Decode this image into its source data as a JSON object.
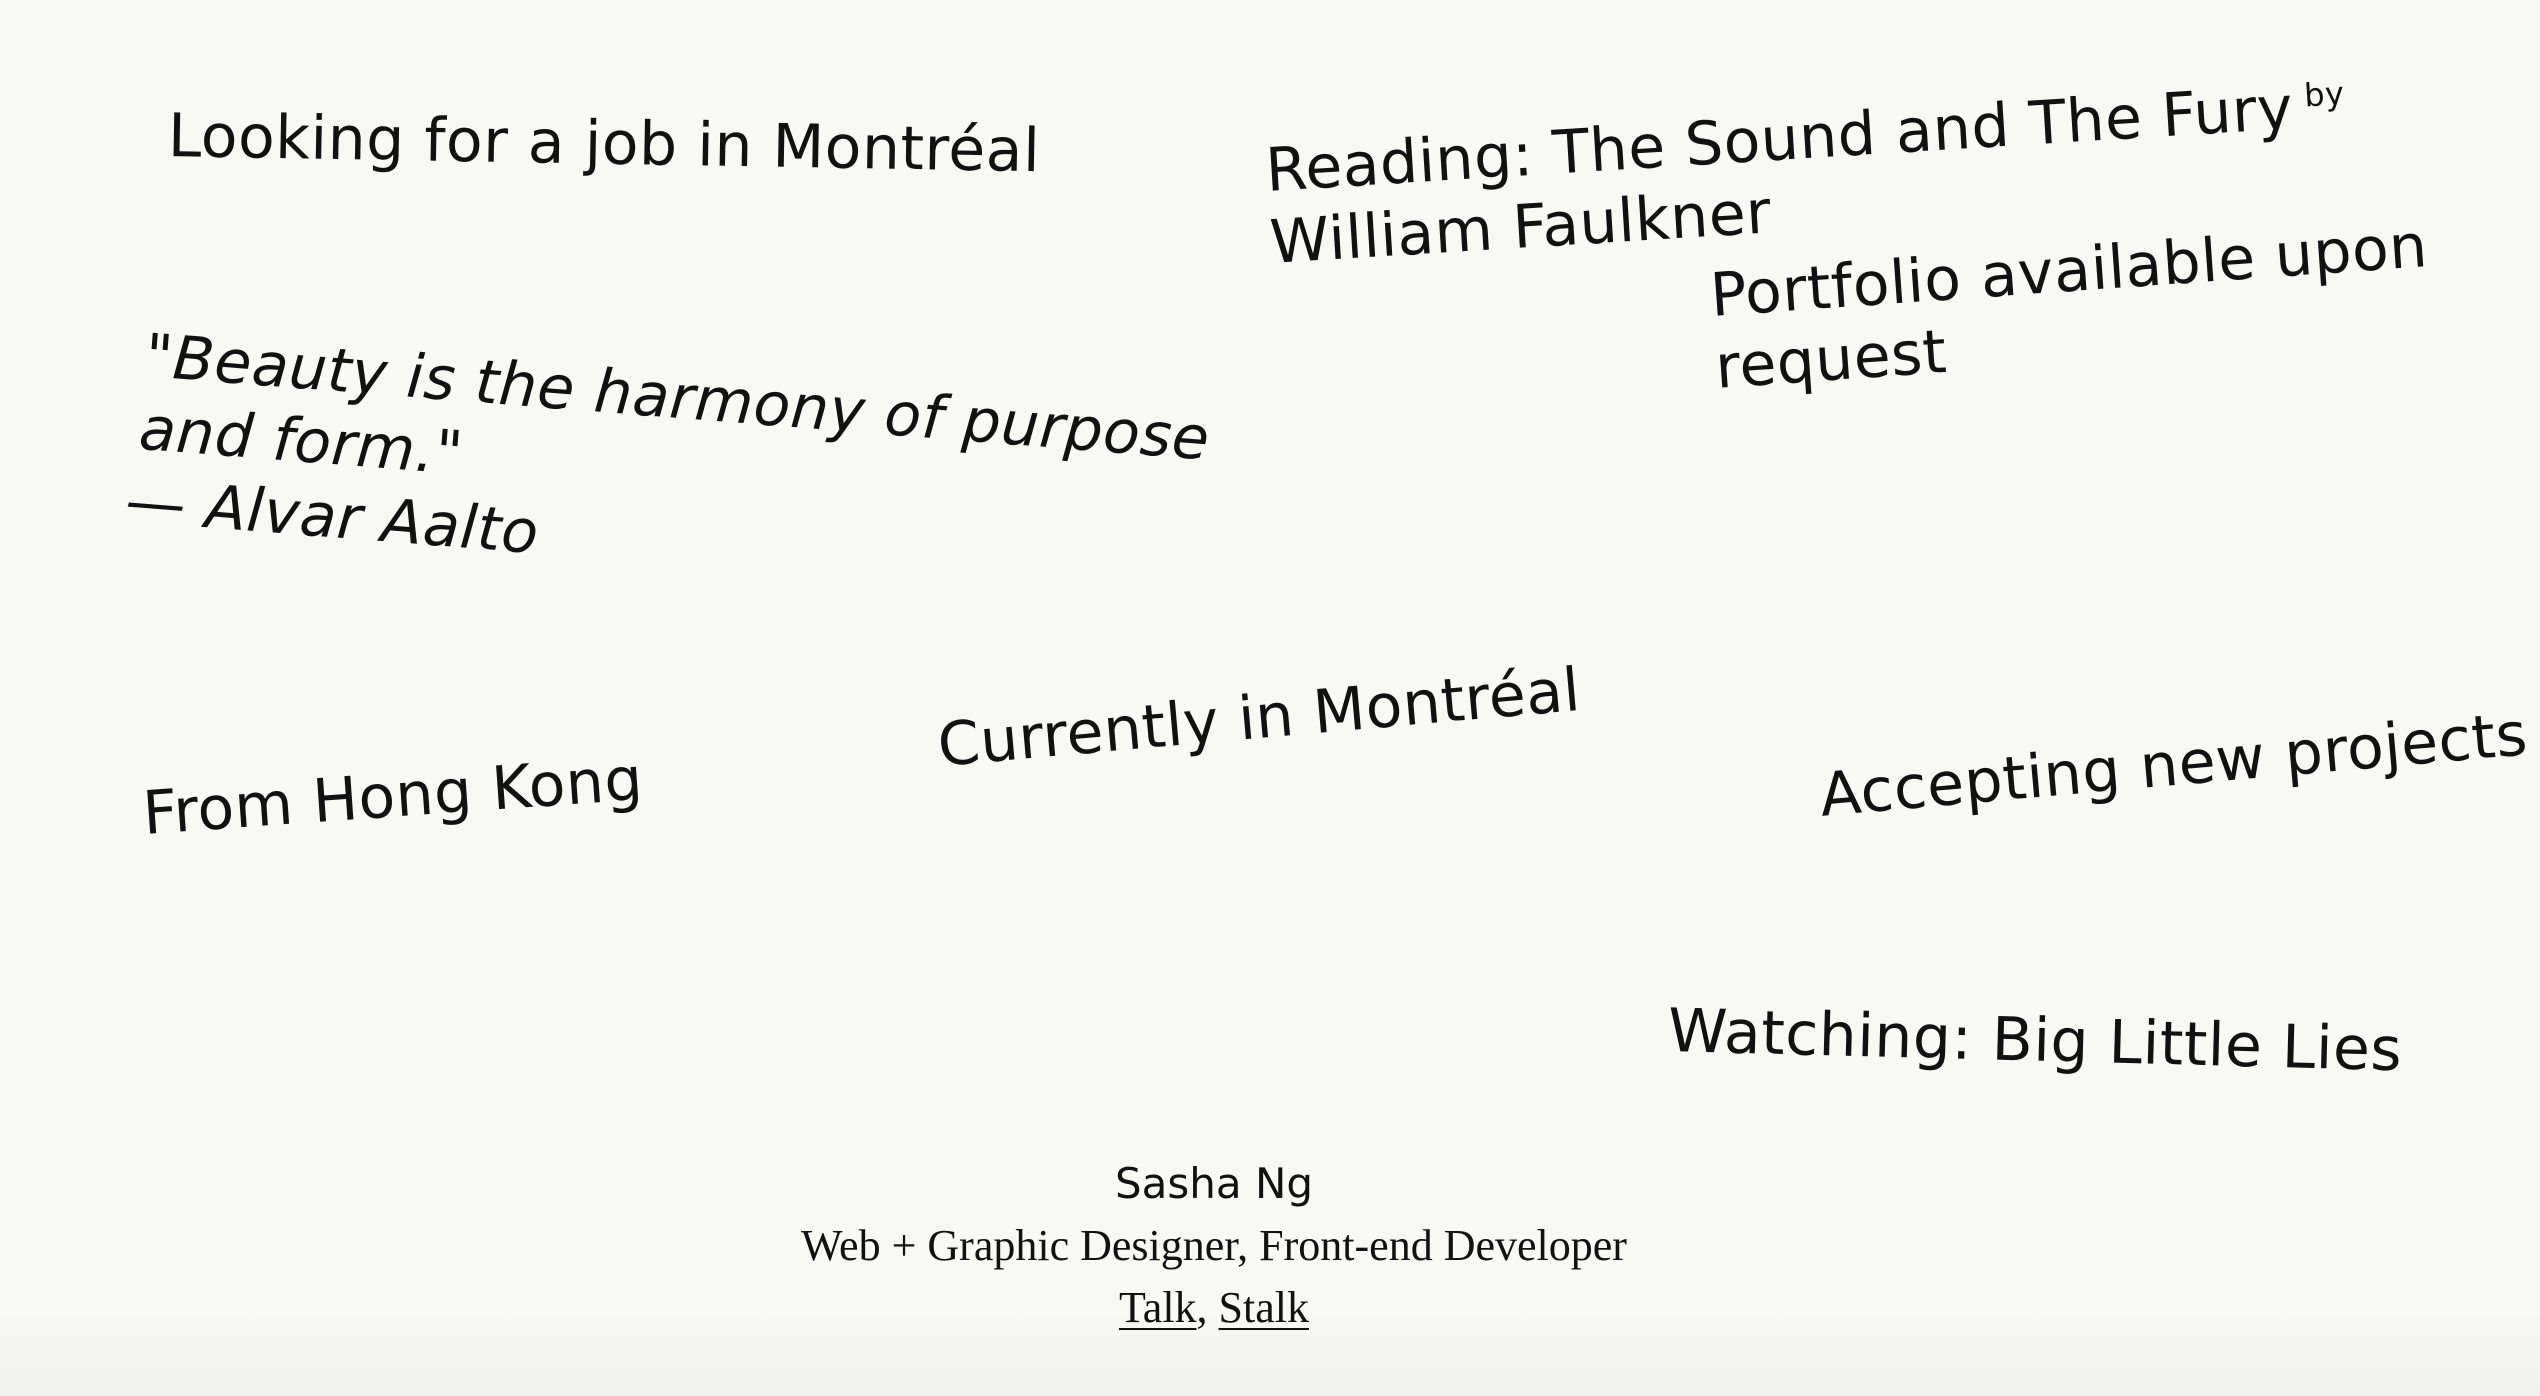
{
  "notes": {
    "job": "Looking for a job in Montréal",
    "reading_prefix": "Reading: The Sound and The Fury",
    "reading_by": "by",
    "reading_author": "William Faulkner",
    "portfolio_line1": "Portfolio available upon",
    "portfolio_line2": "request",
    "quote_text": "\"Beauty is the harmony of purpose and form.\"",
    "quote_author": "— Alvar Aalto",
    "from": "From Hong Kong",
    "currently": "Currently in Montréal",
    "accepting": "Accepting new projects",
    "watching": "Watching: Big Little Lies"
  },
  "footer": {
    "name": "Sasha Ng",
    "role": "Web + Graphic Designer, Front-end Developer",
    "link_talk": "Talk",
    "separator": ",",
    "link_stalk": "Stalk"
  }
}
